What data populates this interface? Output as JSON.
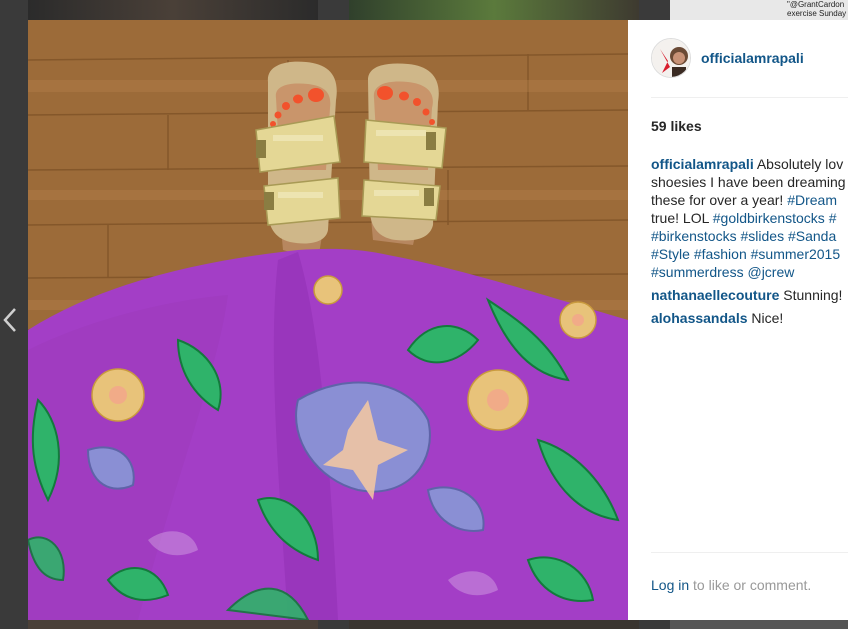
{
  "background": {
    "corner_caption_line1": "\"@GrantCardon",
    "corner_caption_line2": "exercise Sunday"
  },
  "post": {
    "username": "officialamrapali",
    "likes": "59 likes",
    "caption": {
      "user": "officialamrapali",
      "lines": [
        {
          "parts": [
            {
              "t": "text",
              "v": " Absolutely lov"
            }
          ]
        },
        {
          "parts": [
            {
              "t": "text",
              "v": "shoesies I have been dreaming"
            }
          ]
        },
        {
          "parts": [
            {
              "t": "text",
              "v": "these for over a year! "
            },
            {
              "t": "tag",
              "v": "#Dream"
            }
          ]
        },
        {
          "parts": [
            {
              "t": "text",
              "v": "true! LOL "
            },
            {
              "t": "tag",
              "v": "#goldbirkenstocks"
            },
            {
              "t": "text",
              "v": " "
            },
            {
              "t": "tag",
              "v": "#"
            }
          ]
        },
        {
          "parts": [
            {
              "t": "tag",
              "v": "#birkenstocks"
            },
            {
              "t": "text",
              "v": " "
            },
            {
              "t": "tag",
              "v": "#slides"
            },
            {
              "t": "text",
              "v": " "
            },
            {
              "t": "tag",
              "v": "#Sanda"
            }
          ]
        },
        {
          "parts": [
            {
              "t": "tag",
              "v": "#Style"
            },
            {
              "t": "text",
              "v": " "
            },
            {
              "t": "tag",
              "v": "#fashion"
            },
            {
              "t": "text",
              "v": " "
            },
            {
              "t": "tag",
              "v": "#summer2015"
            }
          ]
        },
        {
          "parts": [
            {
              "t": "tag",
              "v": "#summerdress"
            },
            {
              "t": "text",
              "v": " "
            },
            {
              "t": "tag",
              "v": "@jcrew"
            }
          ]
        }
      ]
    },
    "comments": [
      {
        "user": "nathanaellecouture",
        "text": " Stunning!"
      },
      {
        "user": "alohassandals",
        "text": " Nice!"
      }
    ],
    "login_link": "Log in",
    "login_rest": " to like or comment."
  },
  "colors": {
    "link": "#125688",
    "text": "#262626",
    "muted": "#999999",
    "dress_purple": "#a23cc4",
    "sandal_gold": "#d9cf8e",
    "floor_wood": "#9a6a38"
  }
}
